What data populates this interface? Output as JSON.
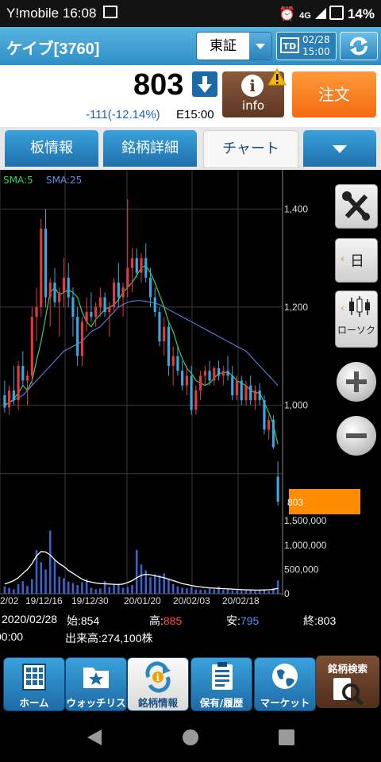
{
  "status_bar": {
    "carrier": "Y!mobile",
    "time": "16:08",
    "network": "4G",
    "battery": "14%"
  },
  "header": {
    "title": "ケイブ[3760]",
    "market": "東証",
    "td_date": "02/28",
    "td_time": "15:00",
    "td_label": "TD"
  },
  "quote": {
    "price": "803",
    "change": "-111(-12.14%)",
    "time": "E15:00",
    "info_label": "info",
    "order_label": "注文"
  },
  "tabs": [
    {
      "label": "板情報"
    },
    {
      "label": "銘柄詳細"
    },
    {
      "label": "チャート"
    },
    {
      "label": ""
    }
  ],
  "chart_data": {
    "type": "candlestick",
    "indicators": [
      "SMA:5",
      "SMA:25"
    ],
    "colors": {
      "up": "#e23b3b",
      "down": "#3aa8e0",
      "sma5": "#33d16a",
      "sma25": "#5a72d8",
      "volume": "#3a62c8",
      "vol_line": "#ffffff"
    },
    "price_ticks": [
      "1,400",
      "1,200",
      "1,000"
    ],
    "price_range": [
      790,
      1480
    ],
    "volume_ticks": [
      "1,500,000",
      "1,000,000",
      "500,000",
      "0"
    ],
    "volume_range": [
      0,
      1700000
    ],
    "x_ticks": [
      "2/02",
      "19/12/16",
      "19/12/30",
      "20/01/20",
      "20/02/03",
      "20/02/18"
    ],
    "last_price_label": "803",
    "candles": [
      {
        "o": 1020,
        "h": 1050,
        "l": 985,
        "c": 995
      },
      {
        "o": 995,
        "h": 1040,
        "l": 980,
        "c": 1030
      },
      {
        "o": 1030,
        "h": 1080,
        "l": 1000,
        "c": 1010
      },
      {
        "o": 1010,
        "h": 1090,
        "l": 990,
        "c": 1080
      },
      {
        "o": 1080,
        "h": 1110,
        "l": 1040,
        "c": 1050
      },
      {
        "o": 1050,
        "h": 1070,
        "l": 1000,
        "c": 1060
      },
      {
        "o": 1060,
        "h": 1200,
        "l": 1040,
        "c": 1180
      },
      {
        "o": 1180,
        "h": 1240,
        "l": 1130,
        "c": 1200
      },
      {
        "o": 1200,
        "h": 1380,
        "l": 1180,
        "c": 1360
      },
      {
        "o": 1360,
        "h": 1400,
        "l": 1200,
        "c": 1220
      },
      {
        "o": 1220,
        "h": 1260,
        "l": 1160,
        "c": 1250
      },
      {
        "o": 1250,
        "h": 1280,
        "l": 1200,
        "c": 1210
      },
      {
        "o": 1210,
        "h": 1240,
        "l": 1140,
        "c": 1230
      },
      {
        "o": 1230,
        "h": 1300,
        "l": 1200,
        "c": 1260
      },
      {
        "o": 1260,
        "h": 1290,
        "l": 1200,
        "c": 1220
      },
      {
        "o": 1220,
        "h": 1240,
        "l": 1140,
        "c": 1180
      },
      {
        "o": 1180,
        "h": 1200,
        "l": 1080,
        "c": 1100
      },
      {
        "o": 1100,
        "h": 1180,
        "l": 1080,
        "c": 1170
      },
      {
        "o": 1170,
        "h": 1220,
        "l": 1150,
        "c": 1190
      },
      {
        "o": 1190,
        "h": 1230,
        "l": 1170,
        "c": 1180
      },
      {
        "o": 1180,
        "h": 1210,
        "l": 1160,
        "c": 1200
      },
      {
        "o": 1200,
        "h": 1240,
        "l": 1180,
        "c": 1220
      },
      {
        "o": 1220,
        "h": 1230,
        "l": 1180,
        "c": 1190
      },
      {
        "o": 1190,
        "h": 1210,
        "l": 1140,
        "c": 1200
      },
      {
        "o": 1200,
        "h": 1260,
        "l": 1190,
        "c": 1250
      },
      {
        "o": 1250,
        "h": 1290,
        "l": 1200,
        "c": 1220
      },
      {
        "o": 1220,
        "h": 1250,
        "l": 1180,
        "c": 1240
      },
      {
        "o": 1240,
        "h": 1420,
        "l": 1220,
        "c": 1280
      },
      {
        "o": 1280,
        "h": 1320,
        "l": 1230,
        "c": 1300
      },
      {
        "o": 1300,
        "h": 1320,
        "l": 1260,
        "c": 1270
      },
      {
        "o": 1270,
        "h": 1310,
        "l": 1250,
        "c": 1300
      },
      {
        "o": 1300,
        "h": 1330,
        "l": 1250,
        "c": 1260
      },
      {
        "o": 1260,
        "h": 1280,
        "l": 1200,
        "c": 1220
      },
      {
        "o": 1220,
        "h": 1240,
        "l": 1180,
        "c": 1190
      },
      {
        "o": 1190,
        "h": 1200,
        "l": 1120,
        "c": 1130
      },
      {
        "o": 1130,
        "h": 1180,
        "l": 1100,
        "c": 1160
      },
      {
        "o": 1160,
        "h": 1170,
        "l": 1060,
        "c": 1080
      },
      {
        "o": 1080,
        "h": 1120,
        "l": 1040,
        "c": 1100
      },
      {
        "o": 1100,
        "h": 1120,
        "l": 1060,
        "c": 1070
      },
      {
        "o": 1070,
        "h": 1090,
        "l": 1030,
        "c": 1040
      },
      {
        "o": 1040,
        "h": 1080,
        "l": 1020,
        "c": 1060
      },
      {
        "o": 1060,
        "h": 1080,
        "l": 980,
        "c": 990
      },
      {
        "o": 990,
        "h": 1040,
        "l": 980,
        "c": 1030
      },
      {
        "o": 1030,
        "h": 1070,
        "l": 1010,
        "c": 1060
      },
      {
        "o": 1060,
        "h": 1080,
        "l": 1040,
        "c": 1070
      },
      {
        "o": 1070,
        "h": 1090,
        "l": 1040,
        "c": 1050
      },
      {
        "o": 1050,
        "h": 1080,
        "l": 1040,
        "c": 1075
      },
      {
        "o": 1075,
        "h": 1090,
        "l": 1050,
        "c": 1060
      },
      {
        "o": 1060,
        "h": 1080,
        "l": 1040,
        "c": 1070
      },
      {
        "o": 1070,
        "h": 1100,
        "l": 1050,
        "c": 1060
      },
      {
        "o": 1060,
        "h": 1080,
        "l": 1010,
        "c": 1020
      },
      {
        "o": 1020,
        "h": 1060,
        "l": 1010,
        "c": 1050
      },
      {
        "o": 1050,
        "h": 1060,
        "l": 1000,
        "c": 1010
      },
      {
        "o": 1010,
        "h": 1050,
        "l": 1000,
        "c": 1040
      },
      {
        "o": 1040,
        "h": 1060,
        "l": 1000,
        "c": 1010
      },
      {
        "o": 1010,
        "h": 1040,
        "l": 990,
        "c": 1030
      },
      {
        "o": 1030,
        "h": 1045,
        "l": 1000,
        "c": 1010
      },
      {
        "o": 1010,
        "h": 1020,
        "l": 940,
        "c": 950
      },
      {
        "o": 950,
        "h": 980,
        "l": 930,
        "c": 970
      },
      {
        "o": 970,
        "h": 980,
        "l": 910,
        "c": 914
      },
      {
        "o": 854,
        "h": 885,
        "l": 795,
        "c": 803
      }
    ],
    "sma5": [
      1000,
      1005,
      1012,
      1025,
      1040,
      1030,
      1050,
      1090,
      1130,
      1180,
      1230,
      1240,
      1225,
      1230,
      1235,
      1230,
      1220,
      1190,
      1170,
      1160,
      1175,
      1185,
      1195,
      1200,
      1205,
      1215,
      1230,
      1240,
      1250,
      1265,
      1280,
      1285,
      1270,
      1250,
      1225,
      1200,
      1170,
      1150,
      1120,
      1095,
      1075,
      1065,
      1050,
      1045,
      1040,
      1045,
      1055,
      1065,
      1065,
      1068,
      1060,
      1050,
      1045,
      1040,
      1030,
      1025,
      1025,
      1005,
      985,
      960,
      920
    ],
    "sma25": [
      1000,
      1005,
      1010,
      1015,
      1020,
      1030,
      1040,
      1050,
      1060,
      1070,
      1080,
      1090,
      1100,
      1110,
      1115,
      1120,
      1125,
      1130,
      1140,
      1150,
      1155,
      1160,
      1170,
      1180,
      1190,
      1200,
      1205,
      1210,
      1212,
      1213,
      1213,
      1212,
      1210,
      1208,
      1205,
      1200,
      1195,
      1190,
      1185,
      1180,
      1175,
      1170,
      1165,
      1160,
      1155,
      1150,
      1145,
      1140,
      1135,
      1130,
      1125,
      1120,
      1115,
      1110,
      1100,
      1090,
      1080,
      1070,
      1060,
      1050,
      1040
    ],
    "volume": [
      150000,
      120000,
      90000,
      200000,
      260000,
      160000,
      300000,
      900000,
      650000,
      500000,
      1300000,
      700000,
      350000,
      320000,
      250000,
      220000,
      180000,
      240000,
      300000,
      120000,
      90000,
      110000,
      260000,
      140000,
      200000,
      200000,
      120000,
      140000,
      180000,
      900000,
      600000,
      480000,
      340000,
      400000,
      380000,
      420000,
      300000,
      200000,
      150000,
      120000,
      110000,
      140000,
      90000,
      80000,
      80000,
      100000,
      90000,
      150000,
      80000,
      90000,
      70000,
      70000,
      60000,
      80000,
      70000,
      60000,
      70000,
      80000,
      50000,
      120000,
      274100
    ],
    "volume_line": [
      200000,
      230000,
      270000,
      330000,
      420000,
      500000,
      620000,
      780000,
      870000,
      860000,
      800000,
      700000,
      620000,
      560000,
      480000,
      420000,
      360000,
      300000,
      260000,
      240000,
      220000,
      210000,
      205000,
      200000,
      195000,
      190000,
      200000,
      230000,
      270000,
      330000,
      380000,
      400000,
      390000,
      370000,
      350000,
      330000,
      300000,
      270000,
      240000,
      210000,
      190000,
      170000,
      150000,
      140000,
      130000,
      120000,
      115000,
      110000,
      105000,
      100000,
      95000,
      90000,
      85000,
      80000,
      78000,
      76000,
      75000,
      78000,
      82000,
      90000,
      110000
    ]
  },
  "side_buttons": {
    "period": "日",
    "chart_type": "ローソク"
  },
  "info": {
    "date": "2020/02/28",
    "open_label": "始:",
    "open": "854",
    "high_label": "高:",
    "high": "885",
    "low_label": "安:",
    "low": "795",
    "close_label": "終:",
    "close": "803",
    "time": "00:00",
    "volume_label": "出来高:",
    "volume": "274,100株"
  },
  "bottom_nav": {
    "items": [
      {
        "label": "ホーム"
      },
      {
        "label": "ウォッチリスト"
      },
      {
        "label": "銘柄情報"
      },
      {
        "label": "保有/履歴"
      },
      {
        "label": "マーケット"
      }
    ],
    "search_label": "銘柄検索"
  }
}
